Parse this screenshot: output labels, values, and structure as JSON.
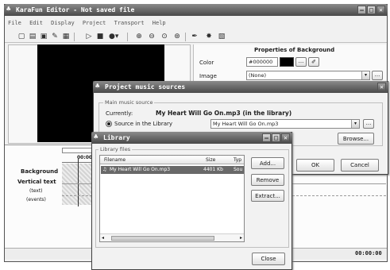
{
  "main_window": {
    "title": "KaraFun Editor - Not saved file",
    "menu": [
      "File",
      "Edit",
      "Display",
      "Project",
      "Transport",
      "Help"
    ],
    "toolbar_icons": [
      "new-icon",
      "open-icon",
      "save-icon",
      "wizard-icon",
      "export-icon",
      "play-icon",
      "stop-icon",
      "record-icon",
      "zoom-in-icon",
      "zoom-out-icon",
      "zoom-fit-icon",
      "zoom-all-icon",
      "brush-icon",
      "effects-icon",
      "settings-icon"
    ]
  },
  "properties": {
    "title": "Properties of Background",
    "color_label": "Color",
    "color_value": "#000000",
    "image_label": "Image",
    "image_value": "(None)"
  },
  "timeline": {
    "labels": [
      "Background",
      "Vertical text",
      "(text)",
      "(events)"
    ],
    "marker": "00:00",
    "time": "00:00:00"
  },
  "music_dialog": {
    "title": "Project music sources",
    "group_label": "Main music source",
    "currently_label": "Currently:",
    "currently_value": "My Heart Will Go On.mp3 (in the library)",
    "source_label": "Source in the Library",
    "source_value": "My Heart Will Go On.mp3",
    "browse_button": "Browse...",
    "ok_button": "OK",
    "cancel_button": "Cancel"
  },
  "library": {
    "title": "Library",
    "group_label": "Library files",
    "columns": [
      "Filename",
      "Size",
      "Typ"
    ],
    "rows": [
      {
        "filename": "My Heart Will Go On.mp3",
        "size": "4401 Kb",
        "type": "Sou"
      }
    ],
    "add_button": "Add...",
    "remove_button": "Remove",
    "extract_button": "Extract...",
    "close_button": "Close"
  },
  "colors": {
    "titlebar": "#5a5a5a",
    "selection": "#6a6a6a",
    "preview": "#000000"
  }
}
